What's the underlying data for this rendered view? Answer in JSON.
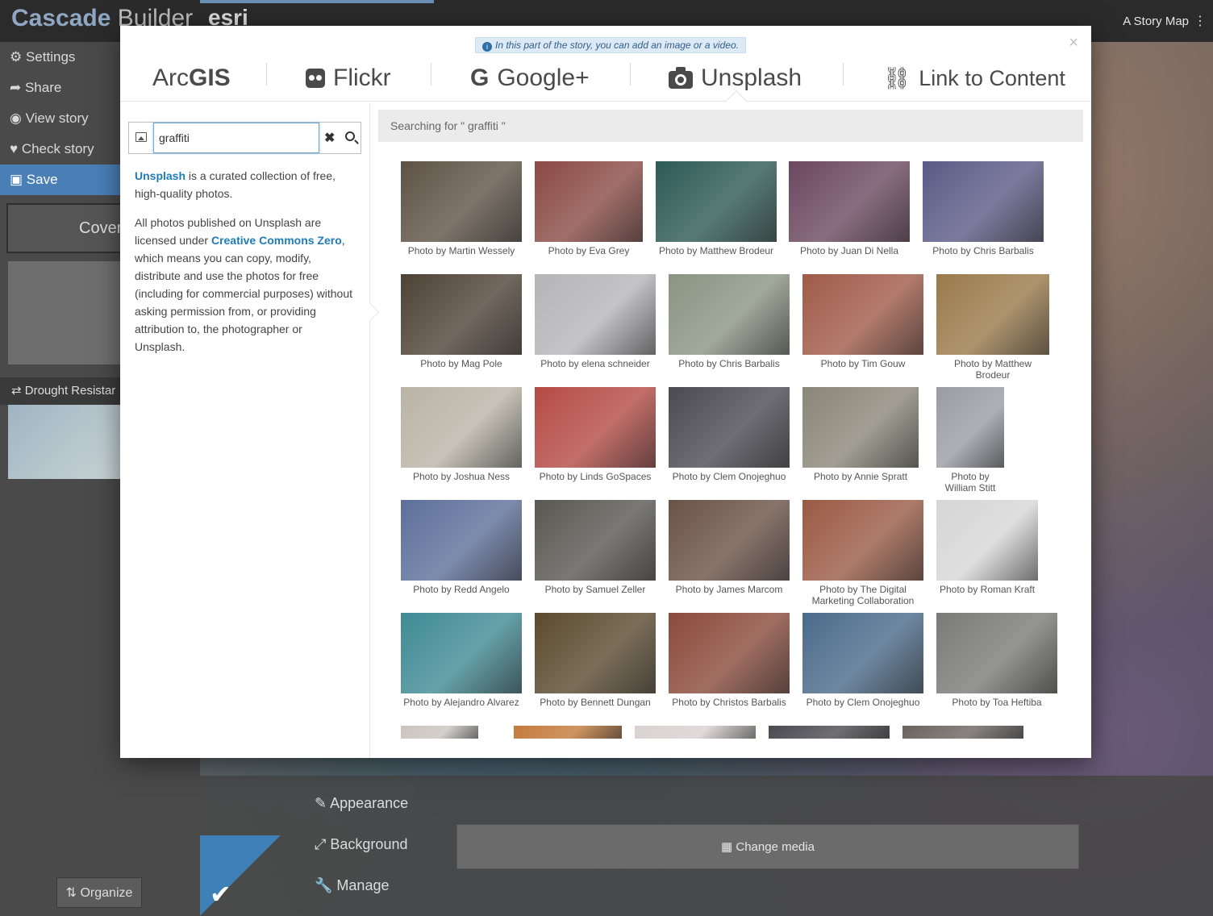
{
  "builder": {
    "brand_a": "Cascade",
    "brand_b": "Builder",
    "esri": "esri",
    "story_map": "A Story Map",
    "nav": [
      "Settings",
      "Share",
      "View story",
      "Check story",
      "Save"
    ],
    "cover": "Cover",
    "section_title": "Drought Resistar",
    "organize": "Organize",
    "tools": [
      "Appearance",
      "Background",
      "Manage"
    ],
    "change_media": "Change media"
  },
  "modal": {
    "hint": "In this part of the story, you can add an image or a video.",
    "close": "×",
    "tabs": {
      "arcgis_a": "Arc",
      "arcgis_b": "GIS",
      "flickr": "Flickr",
      "google": "Google+",
      "unsplash": "Unsplash",
      "link": "Link to Content"
    },
    "search": {
      "value": "graffiti",
      "clear": "✖"
    },
    "description": {
      "unsplash_link": "Unsplash",
      "p1_rest": " is a curated collection of free, high-quality photos.",
      "p2_start": "All photos published on Unsplash are licensed under ",
      "cc_link": "Creative Commons Zero",
      "p2_rest": ", which means you can copy, modify, distribute and use the photos for free (including for commercial purposes) without asking permission from, or providing attribution to, the photographer or Unsplash."
    },
    "status": "Searching for \" graffiti \""
  },
  "photos": [
    {
      "caption": "Photo by Martin Wessely",
      "color": "#5e5245"
    },
    {
      "caption": "Photo by Eva Grey",
      "color": "#8a4a44"
    },
    {
      "caption": "Photo by Matthew Brodeur",
      "color": "#2d5a55"
    },
    {
      "caption": "Photo by Juan Di Nella",
      "color": "#6b4860"
    },
    {
      "caption": "Photo by Chris Barbalis",
      "color": "#5b5a86"
    },
    {
      "caption": "Photo by Mag Pole",
      "color": "#4e4236"
    },
    {
      "caption": "Photo by elena schneider",
      "color": "#b5b5b8"
    },
    {
      "caption": "Photo by Chris Barbalis",
      "color": "#8a9482"
    },
    {
      "caption": "Photo by Tim Gouw",
      "color": "#a05a48"
    },
    {
      "caption": "Photo by Matthew Brodeur",
      "color": "#9a7a4a"
    },
    {
      "caption": "Photo by Joshua Ness",
      "color": "#b9b4a6"
    },
    {
      "caption": "Photo by Linds GoSpaces",
      "color": "#b54a44"
    },
    {
      "caption": "Photo by Clem Onojeghuo",
      "color": "#4b4a52"
    },
    {
      "caption": "Photo by Annie Spratt",
      "color": "#8a8678"
    },
    {
      "caption": "Photo by William Stitt",
      "color": "#9a9ca4"
    },
    {
      "caption": "Photo by Redd Angelo",
      "color": "#5d6f9a"
    },
    {
      "caption": "Photo by Samuel Zeller",
      "color": "#5a5752"
    },
    {
      "caption": "Photo by James Marcom",
      "color": "#6a5246"
    },
    {
      "caption": "Photo by The Digital Marketing Collaboration",
      "color": "#9a5a44"
    },
    {
      "caption": "Photo by Roman Kraft",
      "color": "#d6d6d6"
    },
    {
      "caption": "Photo by Alejandro Alvarez",
      "color": "#3f8a94"
    },
    {
      "caption": "Photo by Bennett Dungan",
      "color": "#5a4a2e"
    },
    {
      "caption": "Photo by Christos Barbalis",
      "color": "#8a4a3a"
    },
    {
      "caption": "Photo by Clem Onojeghuo",
      "color": "#4a6a8a"
    },
    {
      "caption": "Photo by Toa Heftiba",
      "color": "#7a7a78"
    },
    {
      "caption": "",
      "color": "#c9c4bf"
    },
    {
      "caption": "",
      "color": "#c47a3a"
    },
    {
      "caption": "",
      "color": "#d8d2d0"
    },
    {
      "caption": "",
      "color": "#4a4a50"
    },
    {
      "caption": "",
      "color": "#6a6460"
    }
  ]
}
